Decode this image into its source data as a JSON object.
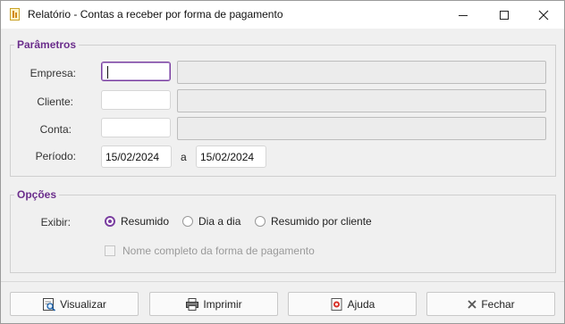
{
  "window": {
    "title": "Relatório - Contas a receber por forma de pagamento"
  },
  "params": {
    "legend": "Parâmetros",
    "empresa_label": "Empresa:",
    "empresa_value": "",
    "cliente_label": "Cliente:",
    "cliente_value": "",
    "conta_label": "Conta:",
    "conta_value": "",
    "periodo_label": "Período:",
    "periodo_start": "15/02/2024",
    "periodo_sep": "a",
    "periodo_end": "15/02/2024"
  },
  "options": {
    "legend": "Opções",
    "exibir_label": "Exibir:",
    "radios": [
      "Resumido",
      "Dia a dia",
      "Resumido por cliente"
    ],
    "selected_radio": "Resumido",
    "checkbox_label": "Nome completo da forma de pagamento",
    "checkbox_checked": false,
    "checkbox_enabled": false
  },
  "buttons": {
    "visualizar": "Visualizar",
    "imprimir": "Imprimir",
    "ajuda": "Ajuda",
    "fechar": "Fechar"
  },
  "colors": {
    "accent": "#7a3ea0",
    "legend": "#6b2e8c"
  },
  "icons": [
    "report-icon",
    "minimize-icon",
    "maximize-icon",
    "close-icon",
    "preview-icon",
    "print-icon",
    "help-icon",
    "close-x-icon"
  ]
}
